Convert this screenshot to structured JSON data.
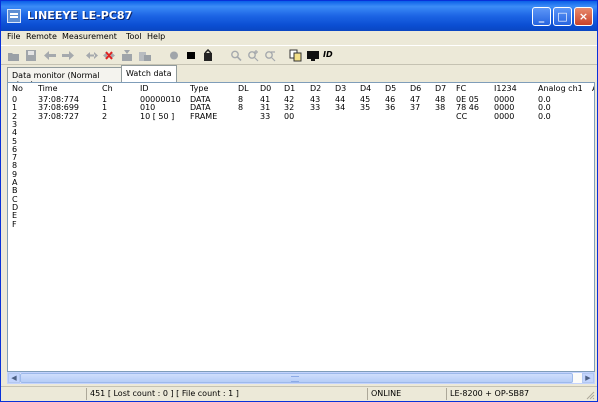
{
  "window": {
    "title": "LINEEYE LE-PC87"
  },
  "menu": [
    "File",
    "Remote",
    "Measurement",
    "Tool",
    "Help"
  ],
  "toolbar": {
    "icons": [
      "open-icon",
      "save-icon",
      "back-icon",
      "forward-icon",
      "jump-icon",
      "stop-marker-icon",
      "trigger-icon",
      "filter-icon",
      "record-icon",
      "stop-icon",
      "export-icon",
      "zoom-icon",
      "zoom-in-icon",
      "zoom-out-icon",
      "copy-icon",
      "monitor-icon",
      "id-icon"
    ],
    "id_label": "ID"
  },
  "tabs": [
    {
      "label": "Data monitor (Normal view)",
      "active": false
    },
    {
      "label": "Watch data",
      "active": true
    }
  ],
  "table": {
    "columns": [
      "No",
      "Time",
      "Ch",
      "ID",
      "Type",
      "DL",
      "D0",
      "D1",
      "D2",
      "D3",
      "D4",
      "D5",
      "D6",
      "D7",
      "FC",
      "I1234",
      "Analog ch1",
      "A"
    ],
    "rows": [
      [
        "0",
        "37:08:774",
        "1",
        "00000010",
        "DATA",
        "8",
        "41",
        "42",
        "43",
        "44",
        "45",
        "46",
        "47",
        "48",
        "0E 05",
        "0000",
        "0.0"
      ],
      [
        "1",
        "37:08:699",
        "1",
        "010",
        "DATA",
        "8",
        "31",
        "32",
        "33",
        "34",
        "35",
        "36",
        "37",
        "38",
        "78 46",
        "0000",
        "0.0"
      ],
      [
        "2",
        "37:08:727",
        "2",
        "10 [ 50 ]",
        "FRAME",
        "",
        "33",
        "00",
        "",
        "",
        "",
        "",
        "",
        "",
        "CC",
        "0000",
        "0.0"
      ],
      [
        "3"
      ],
      [
        "4"
      ],
      [
        "5"
      ],
      [
        "6"
      ],
      [
        "7"
      ],
      [
        "8"
      ],
      [
        "9"
      ],
      [
        "A"
      ],
      [
        "B"
      ],
      [
        "C"
      ],
      [
        "D"
      ],
      [
        "E"
      ],
      [
        "F"
      ]
    ]
  },
  "statusbar": {
    "counts": "451 [ Lost count : 0 ] [ File count : 1 ]",
    "state": "ONLINE",
    "device": "LE-8200 + OP-SB87"
  }
}
